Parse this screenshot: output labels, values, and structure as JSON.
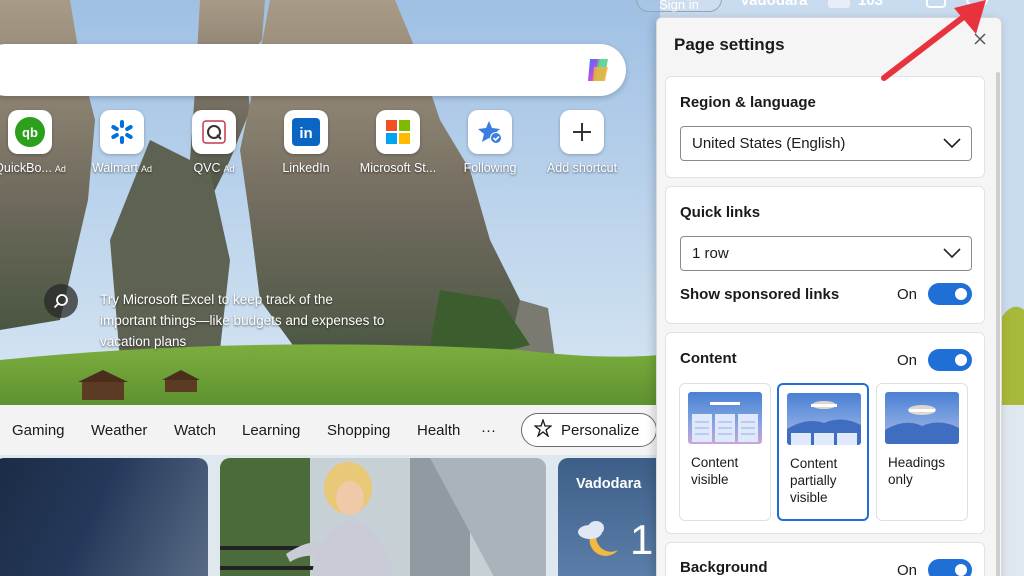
{
  "topbar": {
    "signin_label": "Sign in",
    "location": "Vadodara",
    "temperature": "103"
  },
  "quick_links": [
    {
      "label": "QuickBo...",
      "ad": "Ad",
      "icon": "quickbooks-icon"
    },
    {
      "label": "Walmart",
      "ad": "Ad",
      "icon": "walmart-icon"
    },
    {
      "label": "QVC",
      "ad": "Ad",
      "icon": "qvc-icon"
    },
    {
      "label": "LinkedIn",
      "ad": "",
      "icon": "linkedin-icon"
    },
    {
      "label": "Microsoft St...",
      "ad": "",
      "icon": "microsoft-store-icon"
    },
    {
      "label": "Following",
      "ad": "",
      "icon": "following-icon"
    },
    {
      "label": "Add shortcut",
      "ad": "",
      "icon": "plus-icon"
    }
  ],
  "tip": {
    "text": "Try Microsoft Excel to keep track of the important things—like budgets and expenses to vacation plans"
  },
  "nav": {
    "items": [
      "Gaming",
      "Weather",
      "Watch",
      "Learning",
      "Shopping",
      "Health"
    ],
    "more": "···",
    "personalize_label": "Personalize"
  },
  "weather_card": {
    "city": "Vadodara",
    "temp_partial": "1"
  },
  "settings": {
    "title": "Page settings",
    "region": {
      "title": "Region & language",
      "value": "United States (English)"
    },
    "quick_links": {
      "title": "Quick links",
      "value": "1 row",
      "sponsored_label": "Show sponsored links",
      "sponsored_state": "On"
    },
    "content": {
      "title": "Content",
      "state": "On",
      "options": [
        {
          "label": "Content visible",
          "selected": false
        },
        {
          "label": "Content partially visible",
          "selected": true
        },
        {
          "label": "Headings only",
          "selected": false
        }
      ]
    },
    "background": {
      "title": "Background",
      "state": "On"
    }
  },
  "colors": {
    "accent": "#1f6fd6",
    "arrow": "#e8333f"
  }
}
